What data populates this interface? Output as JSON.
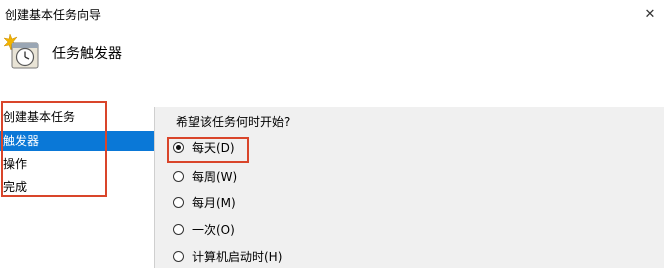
{
  "window": {
    "title": "创建基本任务向导",
    "close_glyph": "✕"
  },
  "header": {
    "title": "任务触发器",
    "icon": "task-scheduler-clock-icon"
  },
  "nav": {
    "items": [
      {
        "label": "创建基本任务",
        "selected": false
      },
      {
        "label": "触发器",
        "selected": true
      },
      {
        "label": "操作",
        "selected": false
      },
      {
        "label": "完成",
        "selected": false
      }
    ],
    "selected_color": "#0a78d7"
  },
  "content": {
    "prompt": "希望该任务何时开始?",
    "options": [
      {
        "label": "每天(D)",
        "checked": true
      },
      {
        "label": "每周(W)",
        "checked": false
      },
      {
        "label": "每月(M)",
        "checked": false
      },
      {
        "label": "一次(O)",
        "checked": false
      },
      {
        "label": "计算机启动时(H)",
        "checked": false
      }
    ]
  },
  "colors": {
    "annotation_box": "#d9452a",
    "body_background": "#f0f0f0"
  }
}
